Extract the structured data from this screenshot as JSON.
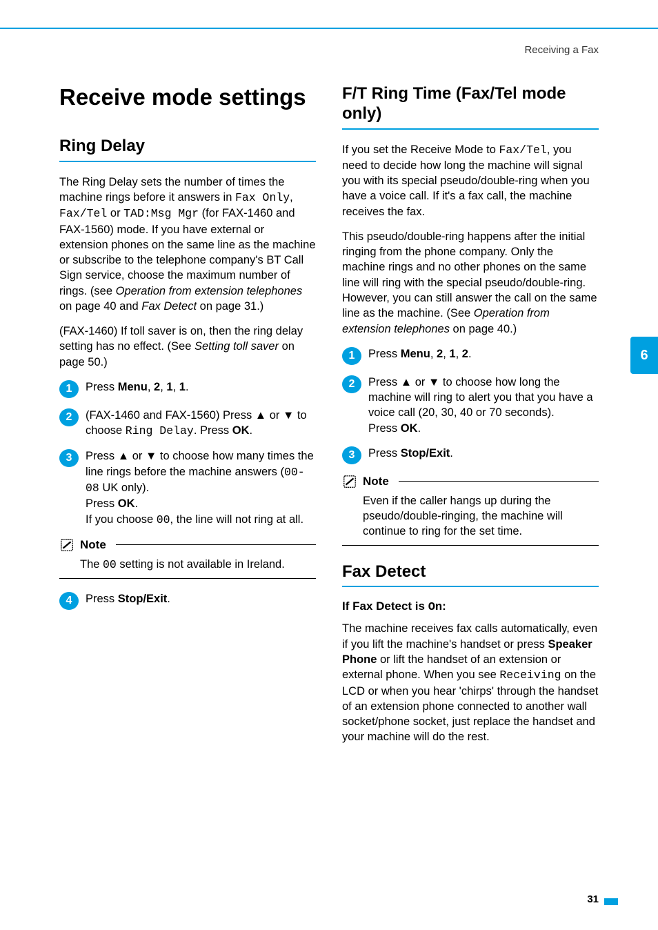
{
  "header": {
    "crumb": "Receiving a Fax"
  },
  "sideTab": "6",
  "pageNumber": "31",
  "left": {
    "h1": "Receive mode settings",
    "ringDelay": {
      "title": "Ring Delay",
      "p1_a": "The Ring Delay sets the number of times the machine rings before it answers in ",
      "p1_mono1": "Fax Only",
      "p1_b": ", ",
      "p1_mono2": "Fax/Tel",
      "p1_c": " or ",
      "p1_mono3": "TAD:Msg Mgr",
      "p1_d": " (for FAX-1460 and FAX-1560) mode. If you have external or extension phones on the same line as the machine or subscribe to the telephone company's BT Call Sign service, choose the maximum number of rings. (see ",
      "p1_it1": "Operation from extension telephones",
      "p1_e": " on page 40 and ",
      "p1_it2": "Fax Detect",
      "p1_f": " on page 31.)",
      "p2_a": "(FAX-1460) If toll saver is on, then the ring delay setting has no effect. (See ",
      "p2_it": "Setting toll saver",
      "p2_b": " on page 50.)",
      "s1_a": "Press ",
      "s1_b": "Menu",
      "s1_c": ", ",
      "s1_d": "2",
      "s1_e": ", ",
      "s1_f": "1",
      "s1_g": ", ",
      "s1_h": "1",
      "s1_i": ".",
      "s2_a": "(FAX-1460 and FAX-1560) Press ",
      "s2_b": " or ",
      "s2_c": " to choose ",
      "s2_mono": "Ring Delay",
      "s2_d": ". Press ",
      "s2_ok": "OK",
      "s2_e": ".",
      "s3_a": "Press ",
      "s3_b": " or ",
      "s3_c": " to choose how many times the line rings before the machine answers (",
      "s3_mono": "00-08",
      "s3_d": " UK only).",
      "s3_e": "Press ",
      "s3_ok": "OK",
      "s3_f": ".",
      "s3_g": "If you choose ",
      "s3_mono2": "00",
      "s3_h": ", the line will not ring at all.",
      "note_title": "Note",
      "note_a": "The ",
      "note_mono": "00",
      "note_b": " setting is not available in Ireland.",
      "s4_a": "Press ",
      "s4_b": "Stop/Exit",
      "s4_c": "."
    }
  },
  "right": {
    "ft": {
      "title": "F/T Ring Time (Fax/Tel mode only)",
      "p1_a": "If you set the Receive Mode to ",
      "p1_mono": "Fax/Tel",
      "p1_b": ", you need to decide how long the machine will signal you with its special pseudo/double-ring when you have a voice call. If it's a fax call, the machine receives the fax.",
      "p2_a": "This pseudo/double-ring happens after the initial ringing from the phone company. Only the machine rings and no other phones on the same line will ring with the special pseudo/double-ring. However, you can still answer the call on the same line as the machine. (See ",
      "p2_it": "Operation from extension telephones",
      "p2_b": " on page 40.)",
      "s1_a": "Press ",
      "s1_menu": "Menu",
      "s1_c": ", ",
      "s1_2": "2",
      "s1_d": ", ",
      "s1_1": "1",
      "s1_e": ", ",
      "s1_22": "2",
      "s1_f": ".",
      "s2_a": "Press ",
      "s2_b": " or ",
      "s2_c": " to choose how long the machine will ring to alert you that you have a voice call (20, 30, 40 or 70 seconds).",
      "s2_d": "Press ",
      "s2_ok": "OK",
      "s2_e": ".",
      "s3_a": "Press ",
      "s3_b": "Stop/Exit",
      "s3_c": ".",
      "note_title": "Note",
      "note_body": "Even if the caller hangs up during the pseudo/double-ringing, the machine will continue to ring for the set time."
    },
    "fd": {
      "title": "Fax Detect",
      "sub_a": "If Fax Detect is ",
      "sub_mono": "On",
      "sub_b": ":",
      "p1_a": "The machine receives fax calls automatically, even if you lift the machine's handset or press ",
      "p1_bold": "Speaker Phone",
      "p1_b": " or lift the handset of an extension or external phone. When you see ",
      "p1_mono": "Receiving",
      "p1_c": " on the LCD or when you hear 'chirps' through the handset of an extension phone connected to another wall socket/phone socket, just replace the handset and your machine will do the rest."
    }
  }
}
